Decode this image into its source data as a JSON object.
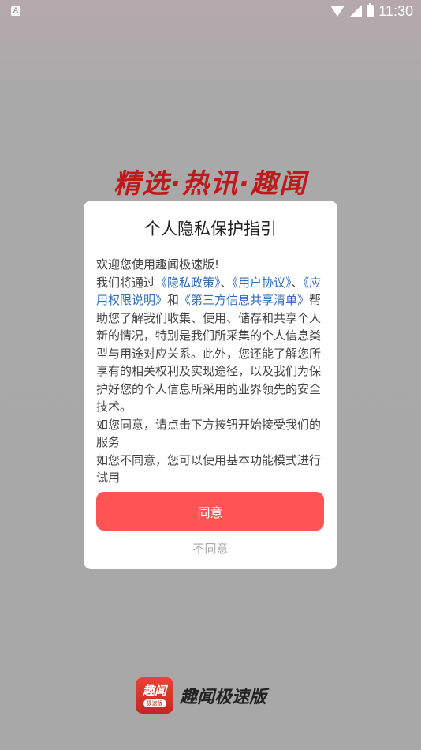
{
  "status_bar": {
    "notification_icon": "A",
    "time": "11:30"
  },
  "slogan": "精选·热讯·趣闻",
  "dialog": {
    "title": "个人隐私保护指引",
    "line_welcome": "欢迎您使用趣闻极速版!",
    "p1_prefix": "我们将通过",
    "link_privacy": "《隐私政策》",
    "sep1": "、",
    "link_user": "《用户协议》",
    "sep2": "、",
    "link_perm": "《应用权限说明》",
    "and": "和",
    "link_third": "《第三方信息共享清单》",
    "p1_rest": "帮助您了解我们收集、使用、储存和共享个人新的情况，特别是我们所采集的个人信息类型与用途对应关系。此外，您还能了解您所享有的相关权利及实现途径，以及我们为保护好您的个人信息所采用的业界领先的安全技术。",
    "p2": "如您同意，请点击下方按钮开始接受我们的服务",
    "p3": "如您不同意，您可以使用基本功能模式进行试用",
    "agree_label": "同意",
    "disagree_label": "不同意"
  },
  "brand": {
    "logo_text": "趣闻",
    "logo_sub": "极速版",
    "name": "趣闻极速版"
  },
  "colors": {
    "accent": "#ff5453",
    "link": "#2f6fb8",
    "slogan": "#c0191c"
  }
}
